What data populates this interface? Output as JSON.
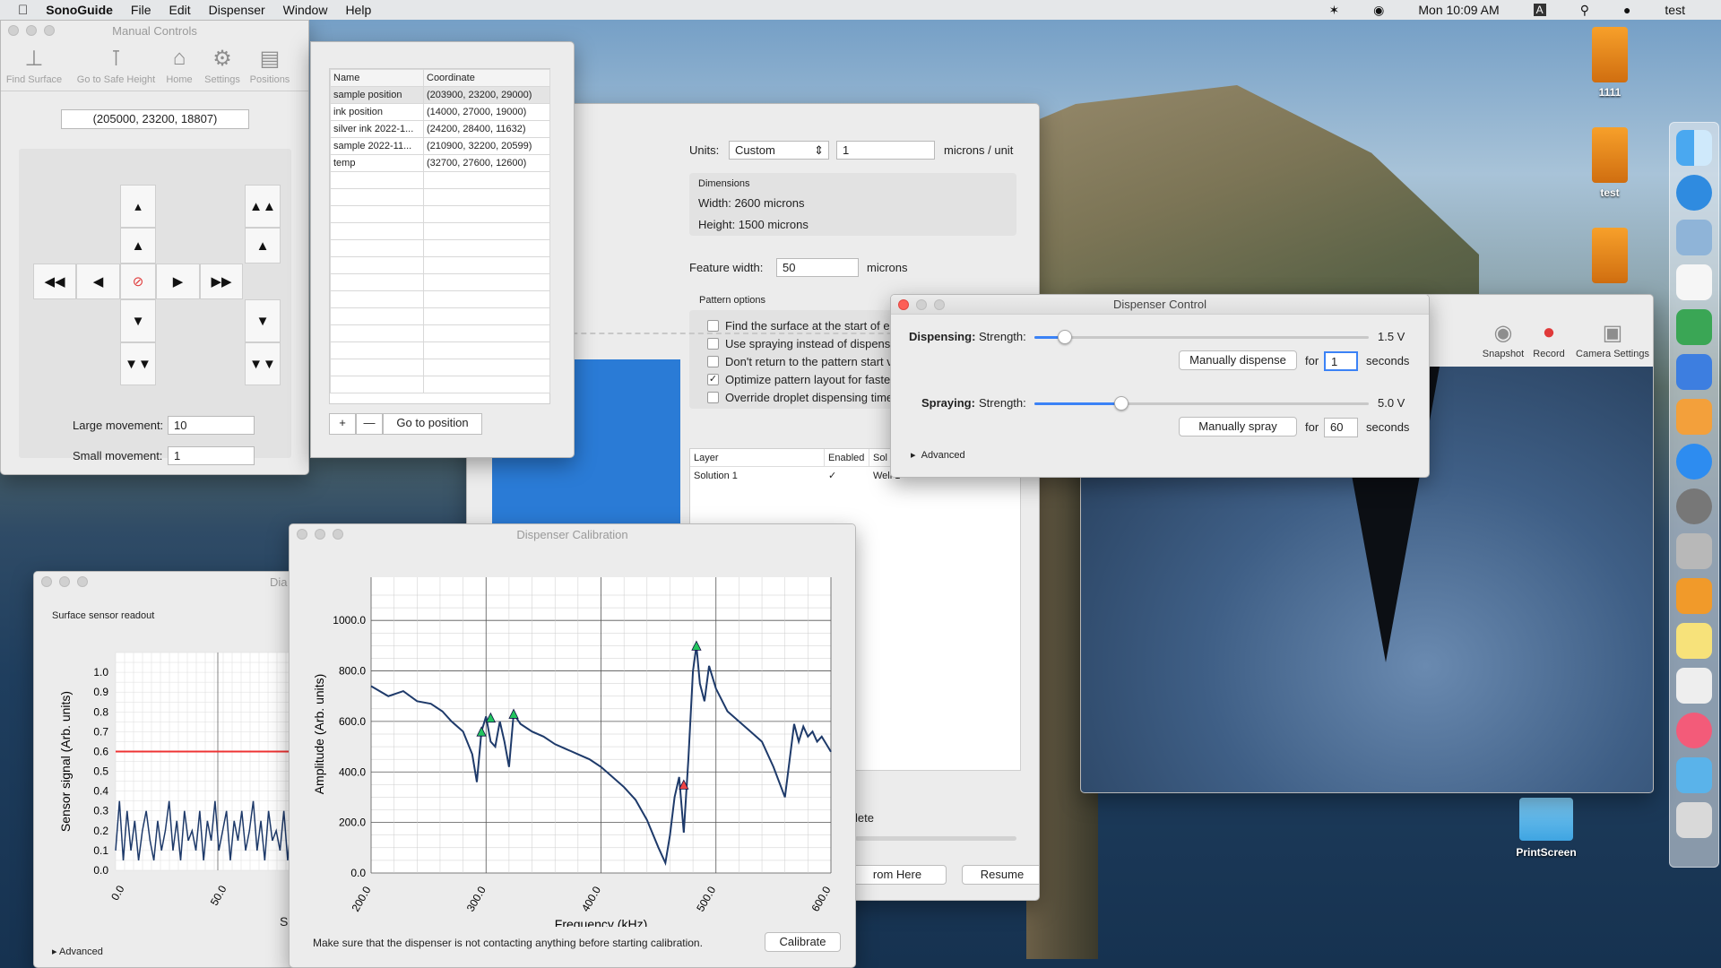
{
  "menubar": {
    "app": "SonoGuide",
    "items": [
      "File",
      "Edit",
      "Dispenser",
      "Window",
      "Help"
    ],
    "clock": "Mon 10:09 AM",
    "input_badge": "A",
    "user": "test"
  },
  "desktop": {
    "icons": [
      {
        "label": "1111"
      },
      {
        "label": "test"
      },
      {
        "label": ""
      },
      {
        "label": "PrintScreen"
      }
    ]
  },
  "manual": {
    "title": "Manual Controls",
    "tools": [
      "Find Surface",
      "Go to Safe Height",
      "Home",
      "Settings",
      "Positions"
    ],
    "position": "(205000, 23200, 18807)",
    "large_label": "Large movement:",
    "large_value": "10",
    "small_label": "Small movement:",
    "small_value": "1"
  },
  "positions": {
    "headers": [
      "Name",
      "Coordinate"
    ],
    "rows": [
      [
        "sample position",
        "(203900, 23200, 29000)"
      ],
      [
        "ink position",
        "(14000, 27000, 19000)"
      ],
      [
        "silver ink 2022-1...",
        "(24200, 28400, 11632)"
      ],
      [
        "sample 2022-11...",
        "(210900, 32200, 20599)"
      ],
      [
        "temp",
        "(32700, 27600, 12600)"
      ]
    ],
    "add": "+",
    "remove": "—",
    "goto": "Go to position"
  },
  "pattern": {
    "units_label": "Units:",
    "units_value": "Custom",
    "units_num": "1",
    "units_suffix": "microns / unit",
    "dimensions_title": "Dimensions",
    "width": "Width: 2600 microns",
    "height": "Height: 1500 microns",
    "feature_label": "Feature width:",
    "feature_value": "50",
    "feature_suffix": "microns",
    "options_title": "Pattern options",
    "options": [
      {
        "text": "Find the surface at the start of ea",
        "checked": false
      },
      {
        "text": "Use spraying instead of dispensi",
        "checked": false
      },
      {
        "text": "Don't return to the pattern start v",
        "checked": false
      },
      {
        "text": "Optimize pattern layout for fastes",
        "checked": true
      },
      {
        "text": "Override droplet dispensing time",
        "checked": false
      }
    ],
    "layer_headers": [
      "Layer",
      "Enabled",
      "Sol"
    ],
    "layer_row": [
      "Solution 1",
      "✓",
      "Well 1"
    ],
    "status_fragment": "lete",
    "from_here": "rom Here",
    "resume": "Resume"
  },
  "dispenser": {
    "title": "Dispenser Control",
    "disp_label": "Dispensing:",
    "strength": "Strength:",
    "disp_v": "1.5 V",
    "disp_level": 0.09,
    "manual_dispense": "Manually dispense",
    "for": "for",
    "disp_secs": "1",
    "seconds": "seconds",
    "spray_label": "Spraying:",
    "spray_v": "5.0 V",
    "spray_level": 0.26,
    "manual_spray": "Manually spray",
    "spray_secs": "60",
    "advanced": "Advanced"
  },
  "camera": {
    "tools": [
      "Snapshot",
      "Record",
      "Camera Settings"
    ]
  },
  "sensor": {
    "title": "Dia",
    "subtitle": "Surface sensor readout",
    "ylabel": "Sensor signal (Arb. units)",
    "xlabel_fragment": "S",
    "yticks": [
      "1.0",
      "0.9",
      "0.8",
      "0.7",
      "0.6",
      "0.5",
      "0.4",
      "0.3",
      "0.2",
      "0.1",
      "0.0"
    ],
    "xticks": [
      "0.0",
      "50.0"
    ],
    "advanced": "Advanced",
    "threshold": 0.6
  },
  "calibration": {
    "title": "Dispenser Calibration",
    "note": "Make sure that the dispenser is not contacting anything before starting calibration.",
    "button": "Calibrate"
  },
  "chart_data": [
    {
      "type": "line",
      "title": "",
      "xlabel": "Frequency (kHz)",
      "ylabel": "Amplitude (Arb. units)",
      "xlim": [
        200,
        600
      ],
      "ylim": [
        0,
        1100
      ],
      "xticks": [
        "200.0",
        "300.0",
        "400.0",
        "500.0",
        "600.0"
      ],
      "yticks": [
        "0.0",
        "200.0",
        "400.0",
        "600.0",
        "800.0",
        "1000.0"
      ],
      "grid": true,
      "series": [
        {
          "x": [
            200,
            215,
            228,
            240,
            252,
            262,
            270,
            280,
            288,
            292,
            296,
            300,
            304,
            308,
            312,
            316,
            320,
            324,
            330,
            340,
            350,
            360,
            370,
            380,
            390,
            400,
            410,
            420,
            430,
            440,
            450,
            456,
            460,
            464,
            468,
            472,
            476,
            480,
            483,
            486,
            490,
            494,
            500,
            510,
            520,
            530,
            540,
            550,
            560,
            568,
            572,
            576,
            580,
            584,
            588,
            592,
            596,
            600
          ],
          "y": [
            740,
            700,
            720,
            680,
            670,
            640,
            600,
            560,
            470,
            360,
            560,
            620,
            520,
            500,
            600,
            520,
            420,
            630,
            590,
            560,
            540,
            510,
            490,
            470,
            450,
            420,
            380,
            340,
            290,
            210,
            100,
            40,
            150,
            300,
            380,
            160,
            450,
            800,
            900,
            750,
            680,
            820,
            730,
            640,
            600,
            560,
            520,
            420,
            300,
            590,
            520,
            580,
            540,
            560,
            520,
            540,
            510,
            480
          ]
        }
      ],
      "markers": [
        {
          "x": 296,
          "y": 560,
          "color": "#22c55e"
        },
        {
          "x": 304,
          "y": 615,
          "color": "#22c55e"
        },
        {
          "x": 324,
          "y": 630,
          "color": "#22c55e"
        },
        {
          "x": 483,
          "y": 900,
          "color": "#22c55e"
        },
        {
          "x": 472,
          "y": 350,
          "color": "#ef4444"
        }
      ]
    },
    {
      "type": "line",
      "title": "",
      "xlabel": "",
      "ylabel": "Sensor signal (Arb. units)",
      "ylim": [
        0,
        1.1
      ],
      "xticks": [
        "0.0",
        "50.0"
      ],
      "yticks": [
        "0.0",
        "0.1",
        "0.2",
        "0.3",
        "0.4",
        "0.5",
        "0.6",
        "0.7",
        "0.8",
        "0.9",
        "1.0"
      ],
      "grid": true,
      "threshold": 0.6,
      "series": [
        {
          "values": [
            0.1,
            0.35,
            0.05,
            0.3,
            0.1,
            0.25,
            0.05,
            0.2,
            0.3,
            0.15,
            0.05,
            0.25,
            0.1,
            0.2,
            0.35,
            0.1,
            0.25,
            0.05,
            0.3,
            0.15,
            0.2,
            0.1,
            0.3,
            0.05,
            0.25,
            0.15,
            0.35,
            0.1,
            0.2,
            0.3,
            0.05,
            0.25,
            0.15,
            0.3,
            0.1,
            0.2,
            0.35,
            0.1,
            0.25,
            0.05,
            0.3,
            0.15,
            0.2,
            0.1,
            0.3,
            0.05,
            0.25,
            0.2,
            0.3,
            0.1
          ]
        }
      ]
    }
  ]
}
